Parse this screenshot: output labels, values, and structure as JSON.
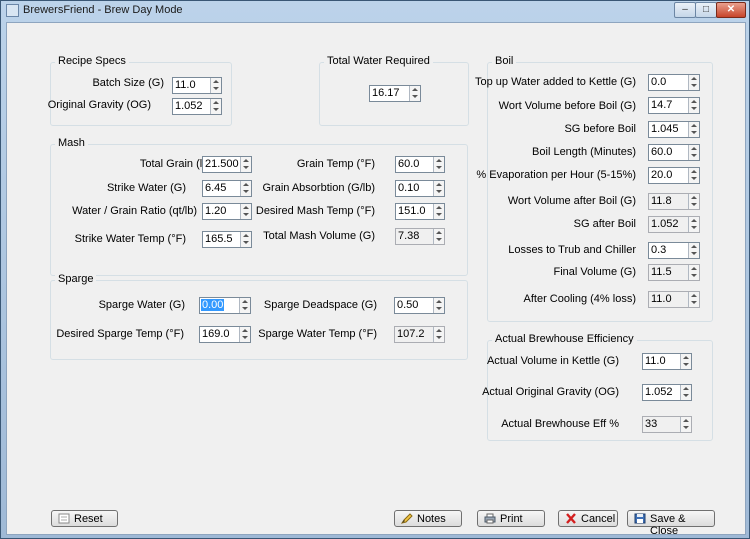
{
  "window": {
    "title": "BrewersFriend - Brew Day Mode",
    "min": "–",
    "max": "□",
    "close": "✕"
  },
  "recipe": {
    "title": "Recipe Specs",
    "batch_label": "Batch Size (G)",
    "batch_value": "11.0",
    "og_label": "Original Gravity (OG)",
    "og_value": "1.052"
  },
  "water": {
    "title": "Total Water Required",
    "value": "16.17"
  },
  "mash": {
    "title": "Mash",
    "total_grain_label": "Total Grain (lb)",
    "total_grain_value": "21.500",
    "strike_water_label": "Strike Water (G)",
    "strike_water_value": "6.45",
    "ratio_label": "Water / Grain Ratio (qt/lb)",
    "ratio_value": "1.20",
    "strike_temp_label": "Strike Water Temp (°F)",
    "strike_temp_value": "165.5",
    "grain_temp_label": "Grain Temp (°F)",
    "grain_temp_value": "60.0",
    "absorb_label": "Grain Absorbtion (G/lb)",
    "absorb_value": "0.10",
    "desired_mash_label": "Desired Mash Temp (°F)",
    "desired_mash_value": "151.0",
    "total_mash_label": "Total Mash Volume (G)",
    "total_mash_value": "7.38"
  },
  "sparge": {
    "title": "Sparge",
    "water_label": "Sparge Water (G)",
    "water_value": "0.00",
    "desired_temp_label": "Desired Sparge Temp (°F)",
    "desired_temp_value": "169.0",
    "deadspace_label": "Sparge Deadspace (G)",
    "deadspace_value": "0.50",
    "water_temp_label": "Sparge Water Temp (°F)",
    "water_temp_value": "107.2"
  },
  "boil": {
    "title": "Boil",
    "topup_label": "Top up Water added to Kettle (G)",
    "topup_value": "0.0",
    "wort_before_label": "Wort Volume before Boil (G)",
    "wort_before_value": "14.7",
    "sg_before_label": "SG before Boil",
    "sg_before_value": "1.045",
    "length_label": "Boil Length (Minutes)",
    "length_value": "60.0",
    "evap_label": "% Evaporation per Hour (5-15%)",
    "evap_value": "20.0",
    "wort_after_label": "Wort Volume after Boil (G)",
    "wort_after_value": "11.8",
    "sg_after_label": "SG after Boil",
    "sg_after_value": "1.052",
    "losses_label": "Losses to Trub and Chiller",
    "losses_value": "0.3",
    "final_label": "Final Volume (G)",
    "final_value": "11.5",
    "cooling_label": "After Cooling (4% loss)",
    "cooling_value": "11.0"
  },
  "efficiency": {
    "title": "Actual Brewhouse Efficiency",
    "vol_label": "Actual Volume in Kettle (G)",
    "vol_value": "11.0",
    "og_label": "Actual Original Gravity (OG)",
    "og_value": "1.052",
    "eff_label": "Actual Brewhouse Eff %",
    "eff_value": "33"
  },
  "buttons": {
    "reset": "Reset",
    "notes": "Notes",
    "print": "Print",
    "cancel": "Cancel",
    "save": "Save & Close"
  }
}
